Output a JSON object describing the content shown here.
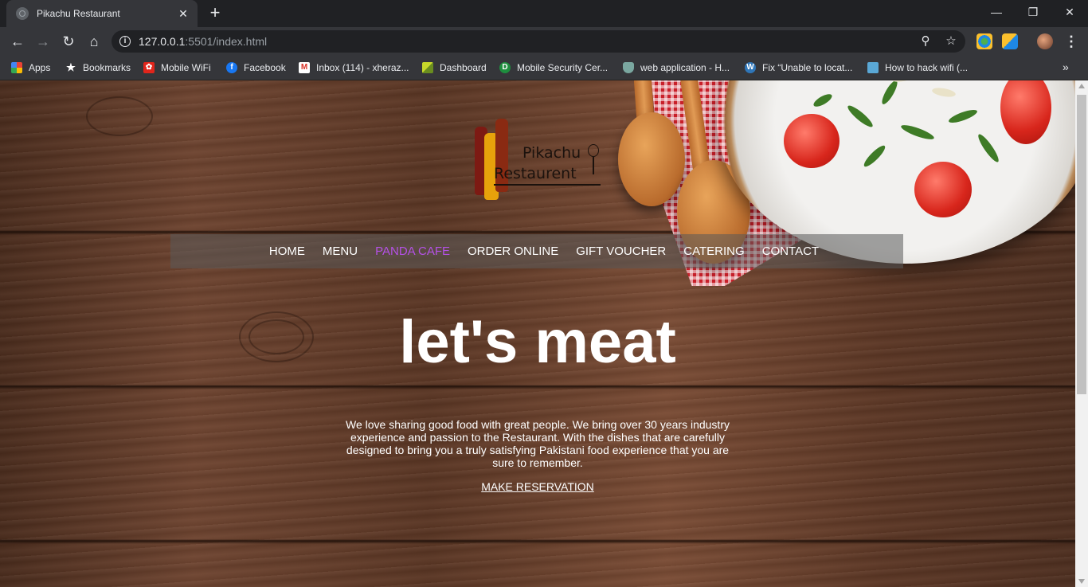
{
  "browser": {
    "tab_title": "Pikachu Restaurant",
    "tab_close": "✕",
    "new_tab": "+",
    "url_host": "127.0.0.1",
    "url_rest": ":5501/index.html",
    "window_controls": {
      "minimize": "—",
      "restore": "❐",
      "close": "✕"
    }
  },
  "bookmarks": [
    {
      "label": "Apps",
      "icon": "apps-grid-icon"
    },
    {
      "label": "Bookmarks",
      "icon": "star-icon"
    },
    {
      "label": "Mobile WiFi",
      "icon": "huawei-icon"
    },
    {
      "label": "Facebook",
      "icon": "facebook-icon"
    },
    {
      "label": "Inbox (114) - xheraz...",
      "icon": "gmail-icon"
    },
    {
      "label": "Dashboard",
      "icon": "dashboard-icon"
    },
    {
      "label": "Mobile Security Cer...",
      "icon": "d-icon"
    },
    {
      "label": "web application - H...",
      "icon": "shield-icon"
    },
    {
      "label": "Fix “Unable to locat...",
      "icon": "wordpress-icon"
    },
    {
      "label": "How to hack wifi (...",
      "icon": "hacker-icon"
    }
  ],
  "logo": {
    "line1": "Pikachu",
    "line2": "Restaurent"
  },
  "nav": {
    "items": [
      "HOME",
      "MENU",
      "PANDA CAFE",
      "ORDER ONLINE",
      "GIFT VOUCHER",
      "CATERING",
      "CONTACT"
    ],
    "active_index": 2,
    "active_color": "#b451e6"
  },
  "hero": {
    "title": "let's meat",
    "text": "We love sharing good food with great people. We bring over 30 years industry experience and passion to the Restaurant. With the dishes that are carefully designed to bring you a truly satisfying Pakistani food experience that you are sure to remember.",
    "cta": "MAKE RESERVATION"
  }
}
